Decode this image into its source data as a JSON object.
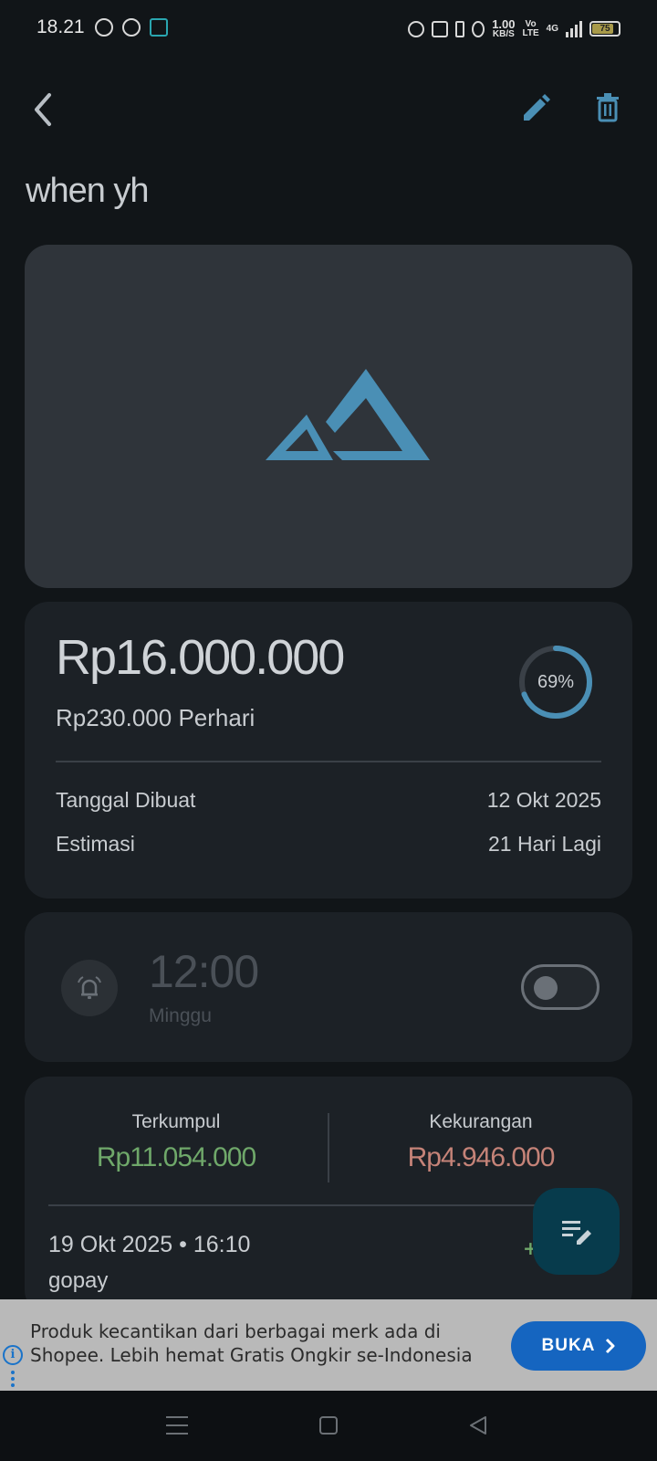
{
  "status_bar": {
    "time": "18.21",
    "speed_value": "1.00",
    "speed_unit": "KB/S",
    "volte_top": "Vo",
    "volte_bottom": "LTE",
    "network": "4G",
    "battery": "75"
  },
  "goal": {
    "title": "when yh",
    "target_amount": "Rp16.000.000",
    "per_day": "Rp230.000 Perhari",
    "progress_label": "69%",
    "progress_fraction": 0.69,
    "created_label": "Tanggal Dibuat",
    "created_value": "12 Okt 2025",
    "estimate_label": "Estimasi",
    "estimate_value": "21 Hari Lagi"
  },
  "reminder": {
    "time": "12:00",
    "day": "Minggu",
    "enabled": false
  },
  "savings": {
    "collected_label": "Terkumpul",
    "collected_value": "Rp11.054.000",
    "shortfall_label": "Kekurangan",
    "shortfall_value": "Rp4.946.000",
    "collected_color": "#6fa86a",
    "shortfall_color": "#c58378",
    "transactions": [
      {
        "datetime": "19 Okt 2025 • 16:10",
        "note": "gopay",
        "amount_prefix": "+"
      }
    ]
  },
  "ad": {
    "text": "Produk kecantikan dari berbagai merk ada di Shopee. Lebih hemat Gratis Ongkir se-Indonesia",
    "button_label": "BUKA",
    "info_glyph": "i"
  },
  "colors": {
    "accent": "#4a8fb5",
    "background": "#111518",
    "card": "#1c2126"
  }
}
